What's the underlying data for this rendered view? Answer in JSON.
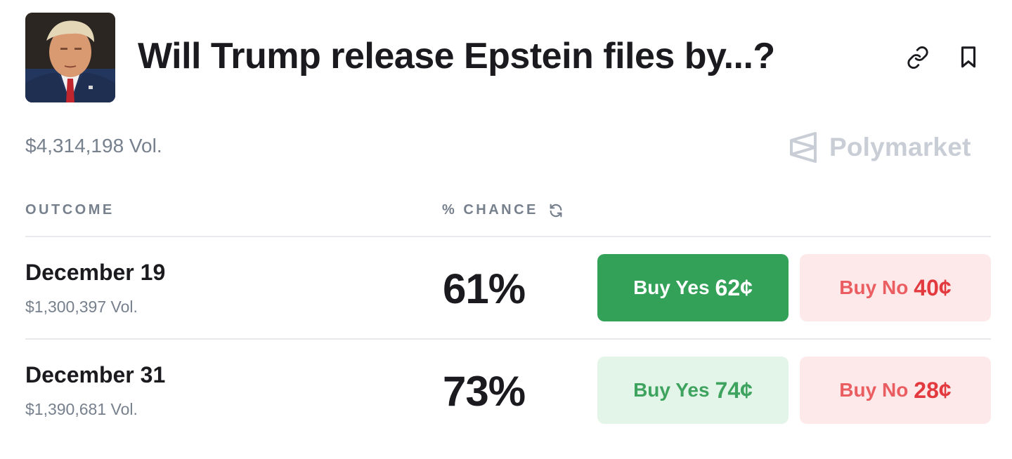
{
  "market": {
    "title": "Will Trump release Epstein files by...?",
    "image_icon": "market-portrait",
    "total_volume": "$4,314,198 Vol.",
    "brand": "Polymarket"
  },
  "table": {
    "headers": {
      "outcome": "OUTCOME",
      "chance": "% CHANCE"
    },
    "rows": [
      {
        "label": "December 19",
        "volume": "$1,300,397 Vol.",
        "chance": "61%",
        "yes": {
          "label": "Buy Yes",
          "price": "62¢"
        },
        "no": {
          "label": "Buy No",
          "price": "40¢"
        }
      },
      {
        "label": "December 31",
        "volume": "$1,390,681 Vol.",
        "chance": "73%",
        "yes": {
          "label": "Buy Yes",
          "price": "74¢"
        },
        "no": {
          "label": "Buy No",
          "price": "28¢"
        }
      }
    ]
  },
  "icons": {
    "link": "link-icon",
    "bookmark": "bookmark-icon",
    "refresh": "refresh-icon",
    "brand": "polymarket-logo-icon"
  },
  "colors": {
    "yes_active": "#34a159",
    "yes_idle_bg": "#e3f5e8",
    "no_idle_bg": "#fde9ea",
    "no_text": "#e23a3f",
    "muted_text": "#77808d"
  }
}
